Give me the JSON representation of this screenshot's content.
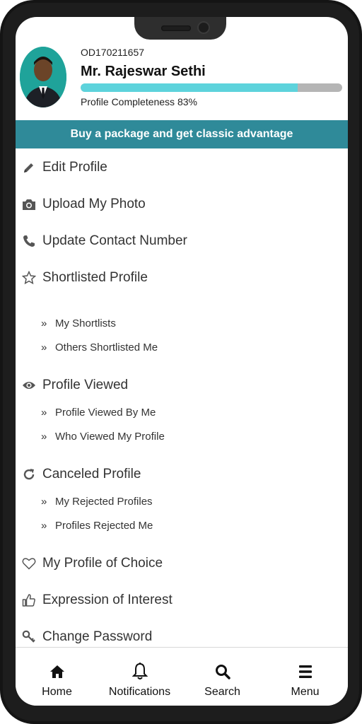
{
  "profile": {
    "id": "OD170211657",
    "name": "Mr. Rajeswar Sethi",
    "completeness_label": "Profile Completeness 83%",
    "completeness_fraction": 0.83
  },
  "banner": {
    "text": "Buy a package and get classic advantage"
  },
  "menu": {
    "edit_profile": "Edit Profile",
    "upload_photo": "Upload My Photo",
    "update_contact": "Update Contact Number",
    "shortlisted": "Shortlisted Profile",
    "my_shortlists": "My Shortlists",
    "others_shortlisted": "Others Shortlisted Me",
    "profile_viewed": "Profile Viewed",
    "viewed_by_me": "Profile Viewed By Me",
    "who_viewed": "Who Viewed My Profile",
    "canceled": "Canceled Profile",
    "my_rejected": "My Rejected Profiles",
    "profiles_rejected_me": "Profiles Rejected Me",
    "profile_of_choice": "My Profile of Choice",
    "expression_interest": "Expression of Interest",
    "change_password": "Change Password",
    "sub_marker": "»"
  },
  "nav": {
    "home": "Home",
    "notifications": "Notifications",
    "search": "Search",
    "menu": "Menu"
  },
  "colors": {
    "banner": "#2f8a99",
    "progress_fill": "#5dd3dc",
    "progress_track": "#b5b5b5"
  }
}
